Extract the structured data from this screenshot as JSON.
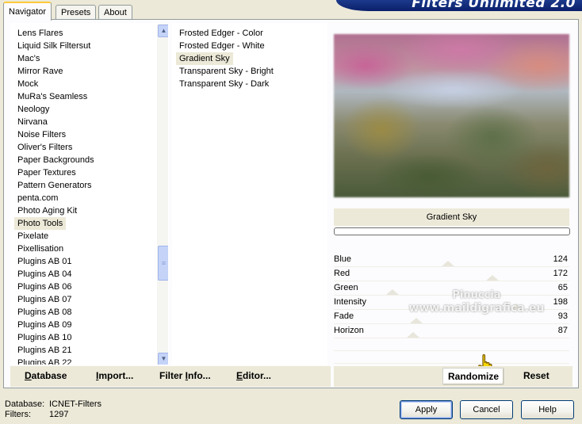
{
  "tabs": [
    "Navigator",
    "Presets",
    "About"
  ],
  "banner": "Filters Unlimited 2.0",
  "categories": [
    "Lens Flares",
    "Liquid Silk Filtersut",
    "Mac's",
    "Mirror Rave",
    "Mock",
    "MuRa's Seamless",
    "Neology",
    "Nirvana",
    "Noise Filters",
    "Oliver's Filters",
    "Paper Backgrounds",
    "Paper Textures",
    "Pattern Generators",
    "penta.com",
    "Photo Aging Kit",
    "Photo Tools",
    "Pixelate",
    "Pixellisation",
    "Plugins AB 01",
    "Plugins AB 04",
    "Plugins AB 06",
    "Plugins AB 07",
    "Plugins AB 08",
    "Plugins AB 09",
    "Plugins AB 10",
    "Plugins AB 21",
    "Plugins AB 22"
  ],
  "selected_category": "Photo Tools",
  "filters": [
    "Frosted Edger - Color",
    "Frosted Edger - White",
    "Gradient Sky",
    "Transparent Sky - Bright",
    "Transparent Sky - Dark"
  ],
  "selected_filter": "Gradient Sky",
  "filter_name": "Gradient Sky",
  "params": [
    {
      "label": "Blue",
      "value": "124"
    },
    {
      "label": "Red",
      "value": "172"
    },
    {
      "label": "Green",
      "value": "65"
    },
    {
      "label": "Intensity",
      "value": "198"
    },
    {
      "label": "Fade",
      "value": "93"
    },
    {
      "label": "Horizon",
      "value": "87"
    }
  ],
  "watermark": [
    "Pinuccia",
    "www.maildigrafica.eu"
  ],
  "bottom_left_buttons": {
    "database": {
      "u": "D",
      "rest": "atabase"
    },
    "import": {
      "u": "I",
      "rest": "mport..."
    },
    "filter_info": {
      "pre": "Filter ",
      "u": "I",
      "rest": "nfo..."
    },
    "editor": {
      "u": "E",
      "rest": "ditor..."
    }
  },
  "randomize_label": "Randomize",
  "reset_label": "Reset",
  "footer": {
    "database_label": "Database:",
    "database_value": "ICNET-Filters",
    "filters_label": "Filters:",
    "filters_value": "1297"
  },
  "dialog_buttons": {
    "apply": "Apply",
    "cancel": "Cancel",
    "help": "Help"
  }
}
